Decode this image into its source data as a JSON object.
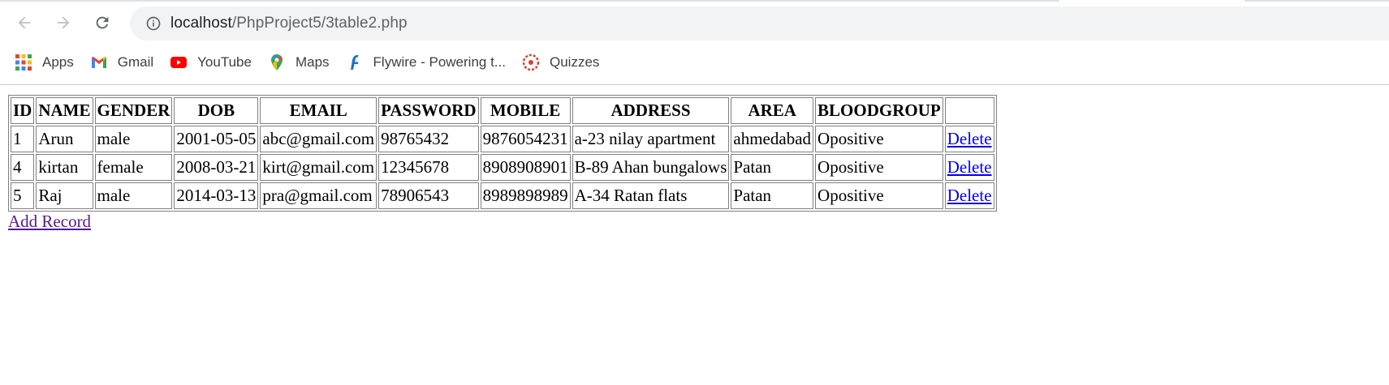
{
  "browser": {
    "url_host": "localhost",
    "url_path": "/PhpProject5/3table2.php",
    "bookmarks": [
      {
        "label": "Apps",
        "icon": "apps-grid-icon"
      },
      {
        "label": "Gmail",
        "icon": "gmail-icon"
      },
      {
        "label": "YouTube",
        "icon": "youtube-icon"
      },
      {
        "label": "Maps",
        "icon": "maps-pin-icon"
      },
      {
        "label": "Flywire - Powering t...",
        "icon": "flywire-icon"
      },
      {
        "label": "Quizzes",
        "icon": "quizzes-icon"
      }
    ]
  },
  "table": {
    "headers": [
      "ID",
      "NAME",
      "GENDER",
      "DOB",
      "EMAIL",
      "PASSWORD",
      "MOBILE",
      "ADDRESS",
      "AREA",
      "BLOODGROUP",
      ""
    ],
    "rows": [
      {
        "id": "1",
        "name": "Arun",
        "gender": "male",
        "dob": "2001-05-05",
        "email": "abc@gmail.com",
        "password": "98765432",
        "mobile": "9876054231",
        "address": "a-23 nilay apartment",
        "area": "ahmedabad",
        "bloodgroup": "Opositive",
        "action": "Delete"
      },
      {
        "id": "4",
        "name": "kirtan",
        "gender": "female",
        "dob": "2008-03-21",
        "email": "kirt@gmail.com",
        "password": "12345678",
        "mobile": "8908908901",
        "address": "B-89 Ahan bungalows",
        "area": "Patan",
        "bloodgroup": "Opositive",
        "action": "Delete"
      },
      {
        "id": "5",
        "name": "Raj",
        "gender": "male",
        "dob": "2014-03-13",
        "email": "pra@gmail.com",
        "password": "78906543",
        "mobile": "8989898989",
        "address": "A-34 Ratan flats",
        "area": "Patan",
        "bloodgroup": "Opositive",
        "action": "Delete"
      }
    ]
  },
  "add_record_label": "Add Record",
  "colors": {
    "link": "#0000ee",
    "visited_link": "#551a8b",
    "omnibox_bg": "#f1f3f4"
  }
}
